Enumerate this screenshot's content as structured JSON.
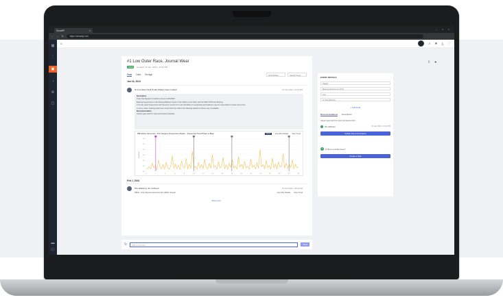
{
  "browser": {
    "tab_title": "SmartPI",
    "url": "https://smartpi.net",
    "window_controls": "– □ ×"
  },
  "topbar": {
    "home_icon": "home-icon",
    "right_icons": [
      "user-avatar",
      "search-icon",
      "star-icon",
      "download-icon",
      "more-icon"
    ]
  },
  "event": {
    "title": "#1 Low Outer Race, Journal Wear",
    "status": "OPEN",
    "created": "Created: 16 Jan, 2024 • 10:22 PM",
    "tabs": [
      "Feed",
      "Data",
      "Storage"
    ],
    "filter_all": "All Activities",
    "search_placeholder": "Search Feed"
  },
  "feed": {
    "date1": "Jan 18, 2024",
    "item1_title": "IN Line Rear Fault Pedal (Roller) bass created",
    "item1_time": "16 Jan 2024 • 10:22 PM",
    "desc_header": "Description",
    "desc_lines": [
      "Outer Fan Bypass Conditions around 1.66VRMS",
      "Bearing frequencies on the Routing Balance Inputs in the Flatline Inner Race with the SEP CRITICAL Bearing.",
      "If not all output frequencies with harmonic sensors fit to are identified of unexpected and wellness may be responsible for these harmonics.",
      "In some cases, bearing faults have transmitted from DE to FE. Bearing faults/non-drives may if available."
    ],
    "rec_header": "Recommendation",
    "rec_text": "Inspect gear teeth for wear and assess lubricate.",
    "chart_title": "PBN Motor Harmonics - 8.2x Sequent Frequencies (Roller) - Sequenced Trend Phase to Base",
    "chart_chip": "Trend",
    "view_plot": "View Plot Details",
    "view_trend": "View Trend",
    "date2": "Feb 1, 2024",
    "item2_title": "Plot added by Jim Johnson",
    "item2_time": "01 Feb 2024 • 09:16 AM",
    "item2_sub": "PBN0 - Outer Bypass Harmonics 9th (Mfilter Speed)",
    "show_more": "Show more",
    "comment_placeholder": "Add a comment",
    "send": "Send"
  },
  "side": {
    "heading": "EVENT DETAILS",
    "fields": [
      "Tagged",
      "Bearing harmonics at 1X-8x",
      "Bearing failure/Harmonics at Race",
      "Low",
      "In Critical/Priority"
    ],
    "add_link": "+ Add Field",
    "tabs": [
      "Recommendations",
      "Description"
    ],
    "rec_text": "Inspect gear teeth for wear and assess lubri...",
    "user": "Jim Johnson",
    "user_time": "01 Jan 2024 • 10:22 PM",
    "rec_button": "Update Recommendation",
    "question": "Is there a similar issue?",
    "question_button": "Create a Task"
  },
  "chart_data": {
    "type": "line",
    "title": "PBN Motor Harmonics - 8.2x Sequent Frequencies (Roller) - Sequenced Trend Phase to Base",
    "xlabel": "",
    "ylabel": "Amplitude",
    "ylim": [
      0,
      0.9
    ],
    "yticks": [
      "0.9",
      "0.7",
      "0.5",
      "0.3",
      "0.2",
      "0.1",
      "0.0"
    ],
    "xticks": [
      "0",
      "2",
      "4",
      "6",
      "8",
      "10",
      "12",
      "14",
      "16",
      "18",
      "20",
      "22",
      "24",
      "26",
      "28",
      "30",
      "32"
    ],
    "series": [
      {
        "values": [
          0.05,
          0.08,
          0.12,
          0.06,
          0.22,
          0.09,
          0.15,
          0.04,
          0.3,
          0.11,
          0.07,
          0.18,
          0.06,
          0.25,
          0.1,
          0.05,
          0.14,
          0.42,
          0.08,
          0.2,
          0.07,
          0.16,
          0.05,
          0.28,
          0.12,
          0.09,
          0.35,
          0.06,
          0.19,
          0.08,
          0.55,
          0.1,
          0.13,
          0.05,
          0.24,
          0.09,
          0.18,
          0.07,
          0.32,
          0.11,
          0.06,
          0.21,
          0.08,
          0.45,
          0.1,
          0.15,
          0.06,
          0.26,
          0.09,
          0.12,
          0.38,
          0.07,
          0.17,
          0.05,
          0.22,
          0.1,
          0.3,
          0.08,
          0.14,
          0.06,
          0.4,
          0.11,
          0.19,
          0.07,
          0.27,
          0.09,
          0.13,
          0.05,
          0.33,
          0.1,
          0.16,
          0.06,
          0.24,
          0.08,
          0.6,
          0.12,
          0.18,
          0.07,
          0.29,
          0.1,
          0.15,
          0.05,
          0.36,
          0.09,
          0.2,
          0.06,
          0.25,
          0.11,
          0.14,
          0.48,
          0.08,
          0.22,
          0.07,
          0.17,
          0.1,
          0.31,
          0.06,
          0.19,
          0.09,
          0.12
        ],
        "color": "#f2c14e"
      }
    ],
    "markers": [
      {
        "x": 2,
        "color": "#c044c8"
      },
      {
        "x": 10,
        "color": "#777777"
      },
      {
        "x": 18,
        "color": "#777777"
      },
      {
        "x": 30,
        "color": "#777777"
      }
    ]
  }
}
